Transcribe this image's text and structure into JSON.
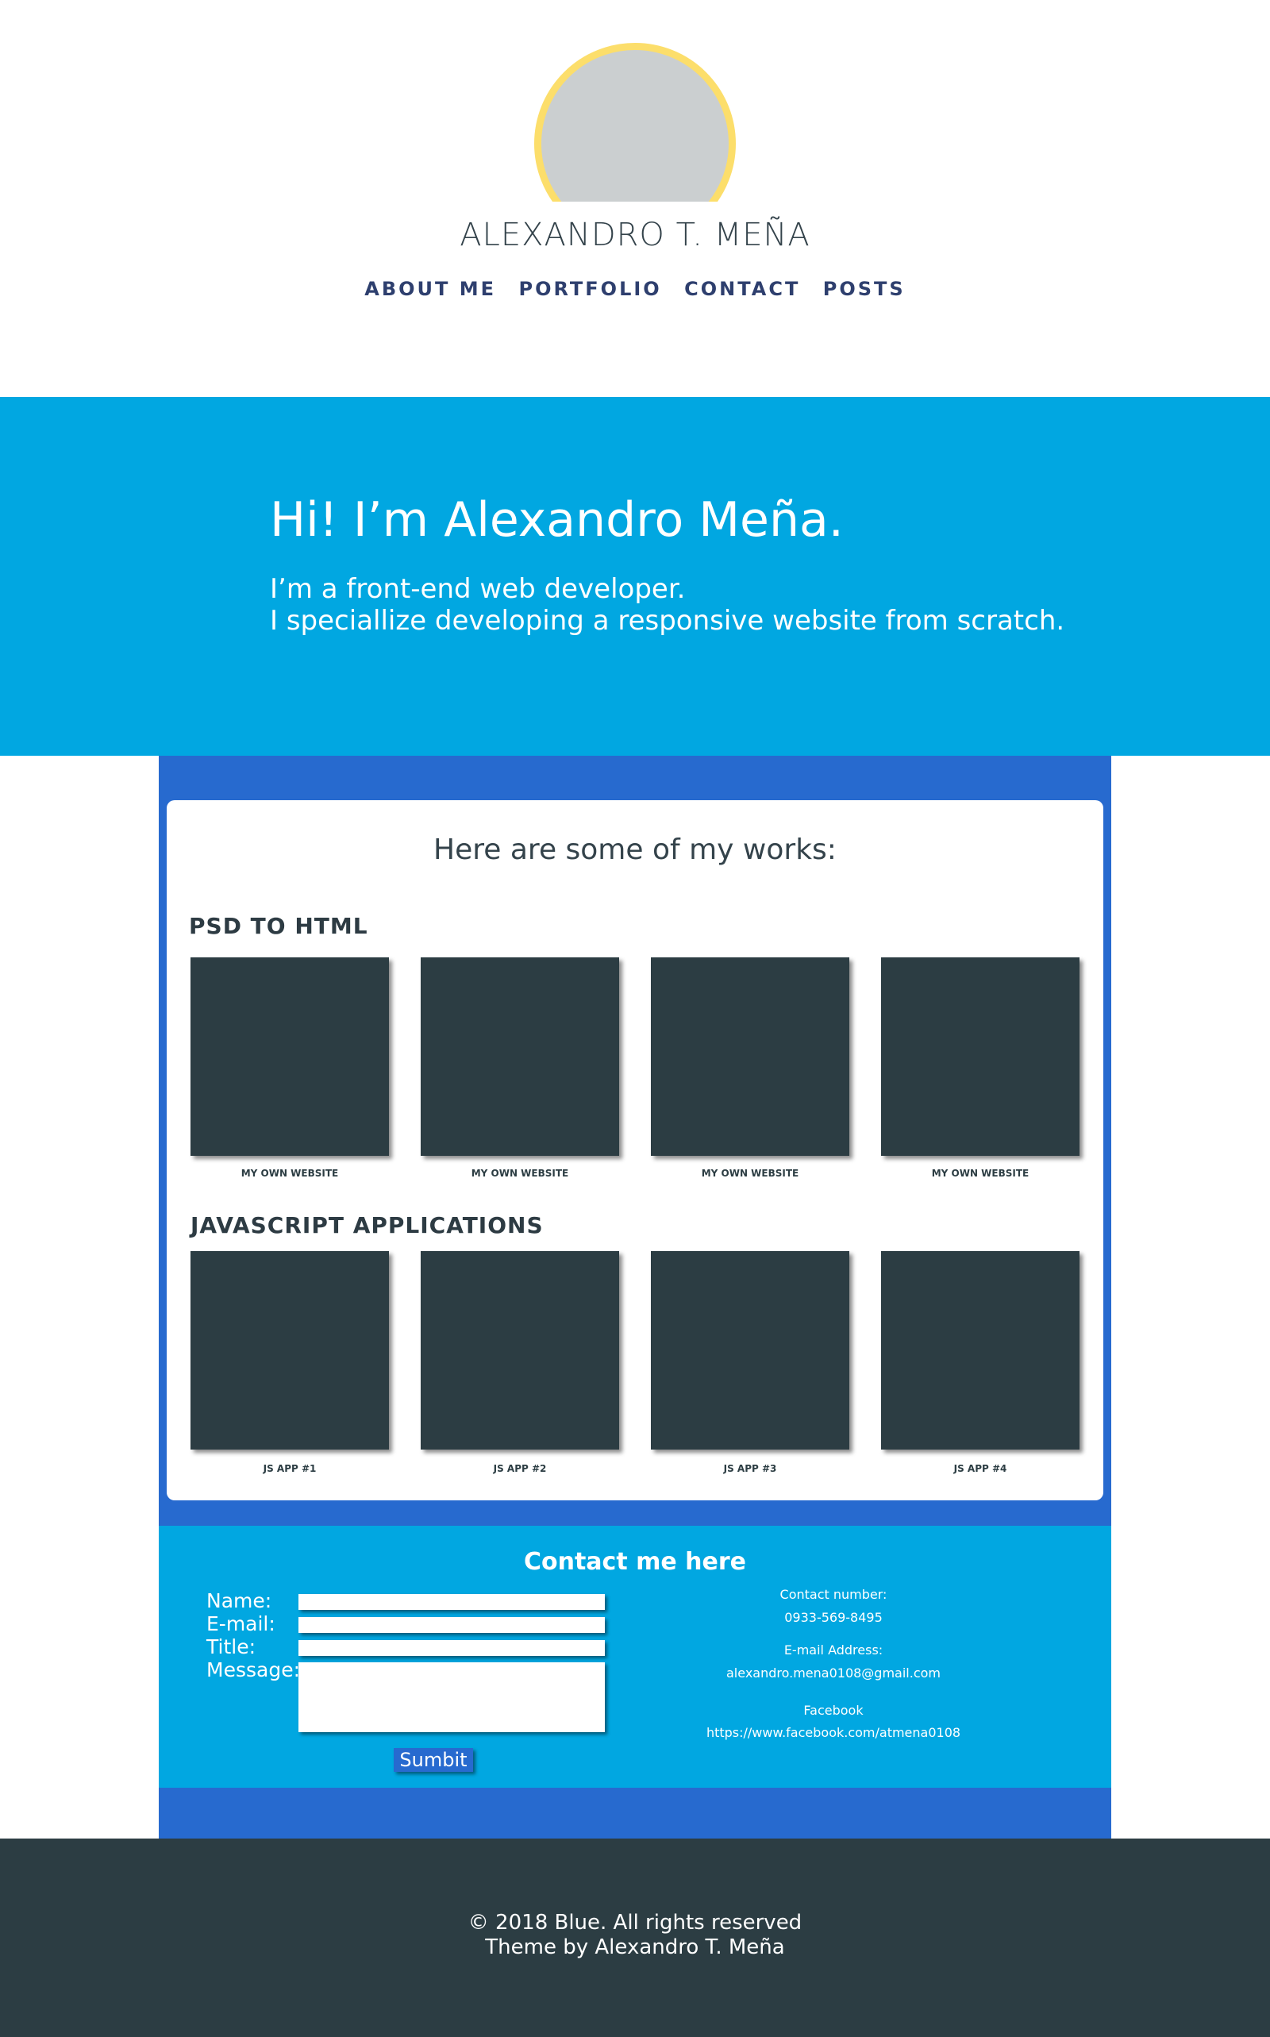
{
  "header": {
    "name": "ALEXANDRO T. MEÑA",
    "nav": [
      "ABOUT ME",
      "PORTFOLIO",
      "CONTACT",
      "POSTS"
    ]
  },
  "hero": {
    "heading": "Hi! I’m Alexandro Meña.",
    "line1": "I’m a front-end web developer.",
    "line2": "I speciallize developing a responsive website from scratch."
  },
  "works": {
    "title": "Here are some of my works:",
    "psd_label": "PSD TO HTML",
    "psd_items": [
      "MY OWN WEBSITE",
      "MY OWN WEBSITE",
      "MY OWN WEBSITE",
      "MY OWN WEBSITE"
    ],
    "js_label": "JAVASCRIPT APPLICATIONS",
    "js_items": [
      "JS APP #1",
      "JS APP #2",
      "JS APP #3",
      "JS APP #4"
    ]
  },
  "contact": {
    "title": "Contact me here",
    "labels": {
      "name": "Name:",
      "email": "E-mail:",
      "title": "Title:",
      "message": "Message:"
    },
    "submit": "Sumbit",
    "number_label": "Contact number:",
    "number": "0933-569-8495",
    "email_label": "E-mail Address:",
    "email": "alexandro.mena0108@gmail.com",
    "facebook_label": "Facebook",
    "facebook": "https://www.facebook.com/atmena0108"
  },
  "footer": {
    "line1": "© 2018 Blue. All rights reserved",
    "line2": "Theme by Alexandro T. Meña"
  },
  "colors": {
    "accent_blue": "#01a7e1",
    "dark_blue": "#276acf",
    "avatar_ring": "#fcde6b",
    "dark": "#2c3d43"
  }
}
